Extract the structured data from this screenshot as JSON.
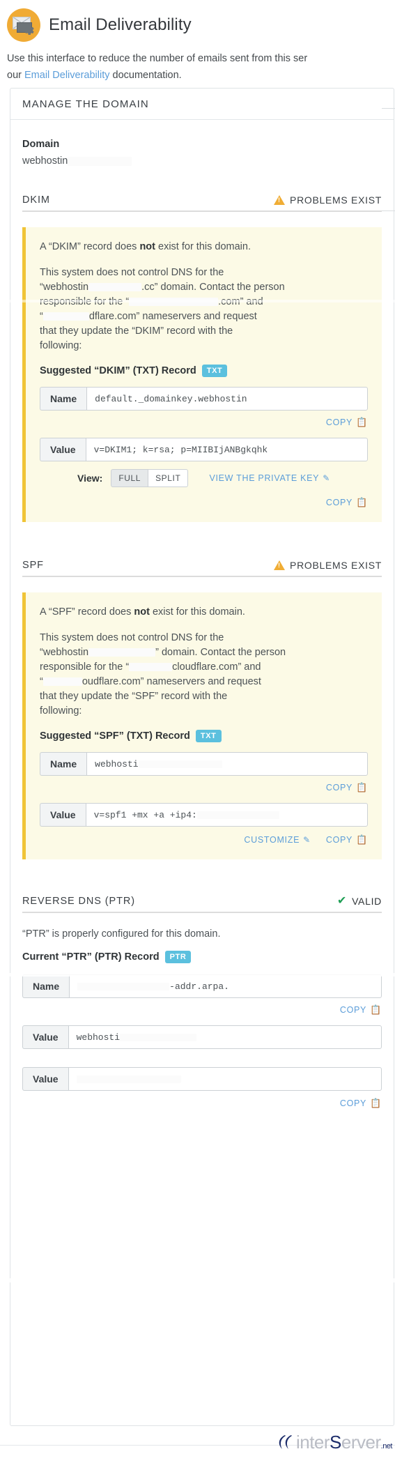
{
  "header": {
    "title": "Email Deliverability",
    "icon": "email-gear-icon"
  },
  "intro": {
    "line1": "Use this interface to reduce the number of emails sent from this ser",
    "line2_prefix": "our ",
    "line2_link": "Email Deliverability",
    "line2_suffix": " documentation."
  },
  "panel": {
    "title": "MANAGE THE DOMAIN",
    "domain_label": "Domain",
    "domain_value": "webhostin"
  },
  "dkim": {
    "name": "DKIM",
    "status": "PROBLEMS EXIST",
    "status_icon": "warning-triangle-icon",
    "alert_pre": "A “DKIM” record does ",
    "alert_bold": "not",
    "alert_post": " exist for this domain.",
    "para_1": "This system does not control DNS for the",
    "para_2_pre": "“webhostin",
    "para_2_post": ".cc” domain. Contact the person",
    "para_3_pre": "responsible for the “",
    "para_3_post": ".com” and",
    "para_4_pre": "“",
    "para_4_mid": "dflare.com” nameservers and request",
    "para_5": "that they update the “DKIM” record with the",
    "para_6": "following:",
    "suggested_label": "Suggested “DKIM” (TXT) Record",
    "suggested_badge": "TXT",
    "name_addon": "Name",
    "name_value": "default._domainkey.webhostin",
    "value_addon": "Value",
    "value_value": "v=DKIM1; k=rsa; p=MIIBIjANBgkqhk",
    "copy_label": "COPY",
    "copy_icon": "copy-icon",
    "view_label": "View:",
    "view_full": "FULL",
    "view_split": "SPLIT",
    "private_key_label": "VIEW THE PRIVATE KEY",
    "pencil_icon": "pencil-icon"
  },
  "spf": {
    "name": "SPF",
    "status": "PROBLEMS EXIST",
    "status_icon": "warning-triangle-icon",
    "alert_pre": "A “SPF” record does ",
    "alert_bold": "not",
    "alert_post": " exist for this domain.",
    "para_1": "This system does not control DNS for the",
    "para_2_pre": "“webhostin",
    "para_2_post": "” domain. Contact the person",
    "para_3_pre": "responsible for the “",
    "para_3_post": "cloudflare.com” and",
    "para_4_pre": "“",
    "para_4_mid": "oudflare.com” nameservers and request",
    "para_5": "that they update the “SPF” record with the",
    "para_6": "following:",
    "suggested_label": "Suggested “SPF” (TXT) Record",
    "suggested_badge": "TXT",
    "name_addon": "Name",
    "name_value": "webhosti",
    "value_addon": "Value",
    "value_value": "v=spf1 +mx +a +ip4:",
    "copy_label": "COPY",
    "customize_label": "CUSTOMIZE",
    "copy_icon": "copy-icon",
    "pencil_icon": "pencil-icon"
  },
  "ptr": {
    "name": "REVERSE DNS (PTR)",
    "status": "VALID",
    "status_icon": "check-icon",
    "message": "“PTR” is properly configured for this domain.",
    "current_label": "Current “PTR” (PTR) Record",
    "current_badge": "PTR",
    "name_addon": "Name",
    "name_value_suffix": "-addr.arpa.",
    "value_addon": "Value",
    "value_value": "webhosti",
    "value_addon_2": "Value",
    "copy_label": "COPY",
    "copy_icon": "copy-icon"
  },
  "footer": {
    "logo_text": "inter",
    "logo_text_2": "erver",
    "logo_tld": ".net",
    "logo_name": "interserver-logo"
  },
  "colors": {
    "accent_yellow": "#f0c437",
    "link_blue": "#5b9dd9",
    "badge_blue": "#5bc0de",
    "valid_green": "#1e9e54",
    "callout_bg": "#fcfae6"
  }
}
